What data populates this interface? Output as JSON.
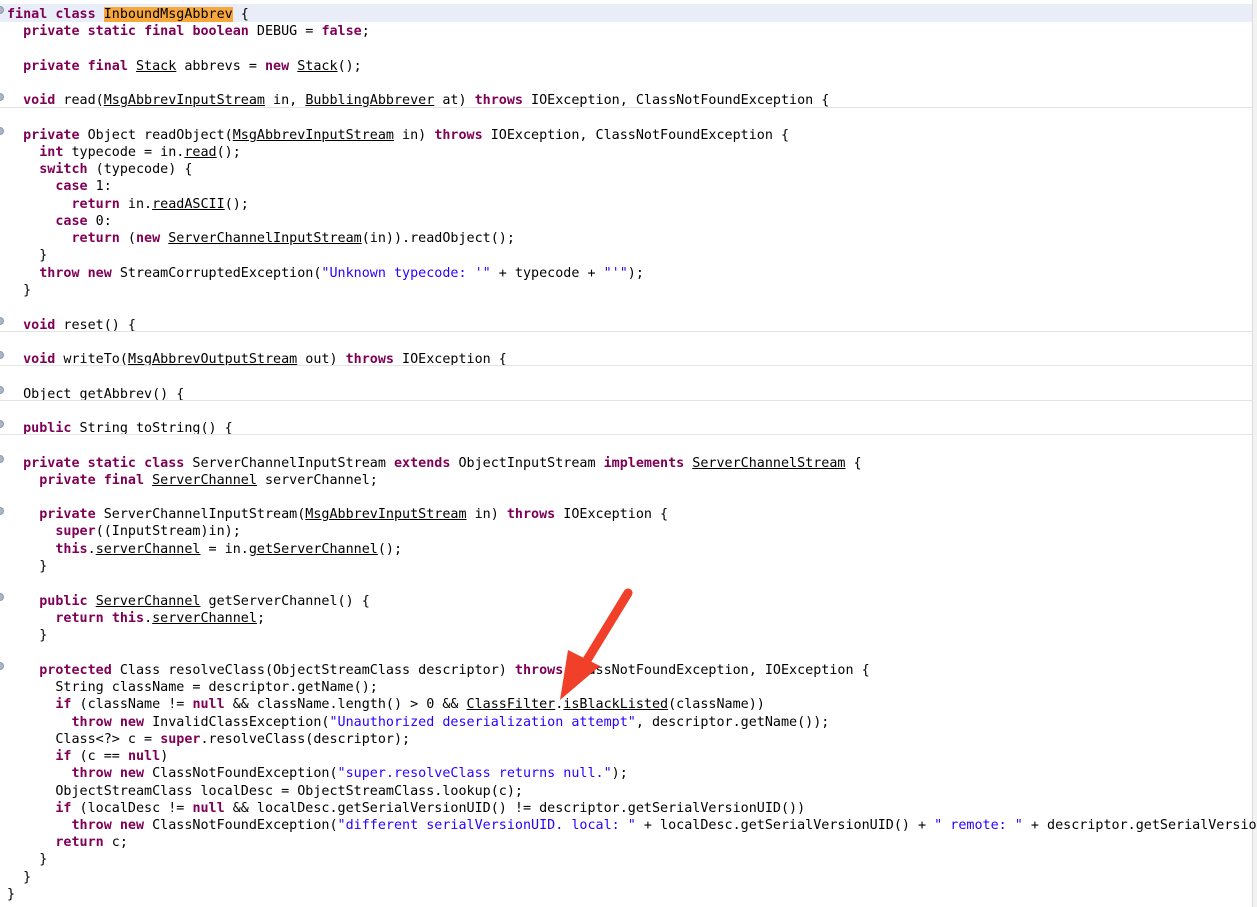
{
  "editor": {
    "lines": [
      [
        {
          "t": "final",
          "c": "kw"
        },
        {
          "t": " "
        },
        {
          "t": "class",
          "c": "kw"
        },
        {
          "t": " "
        },
        {
          "t": "InboundMsgAbbrev",
          "c": "hl"
        },
        {
          "t": " {"
        }
      ],
      [
        {
          "t": "  "
        },
        {
          "t": "private",
          "c": "kw"
        },
        {
          "t": " "
        },
        {
          "t": "static",
          "c": "kw"
        },
        {
          "t": " "
        },
        {
          "t": "final",
          "c": "kw"
        },
        {
          "t": " "
        },
        {
          "t": "boolean",
          "c": "kw"
        },
        {
          "t": " DEBUG = "
        },
        {
          "t": "false",
          "c": "kw"
        },
        {
          "t": ";"
        }
      ],
      [
        {
          "t": "  "
        },
        {
          "t": "private",
          "c": "kw"
        },
        {
          "t": " "
        },
        {
          "t": "final",
          "c": "kw"
        },
        {
          "t": " "
        },
        {
          "t": "Stack",
          "c": "ul"
        },
        {
          "t": " abbrevs = "
        },
        {
          "t": "new",
          "c": "kw"
        },
        {
          "t": " "
        },
        {
          "t": "Stack",
          "c": "ul"
        },
        {
          "t": "();"
        }
      ],
      [
        {
          "t": "  "
        },
        {
          "t": "void",
          "c": "kw"
        },
        {
          "t": " read("
        },
        {
          "t": "MsgAbbrevInputStream",
          "c": "ul"
        },
        {
          "t": " in, "
        },
        {
          "t": "BubblingAbbrever",
          "c": "ul"
        },
        {
          "t": " at) "
        },
        {
          "t": "throws",
          "c": "kw"
        },
        {
          "t": " IOException, ClassNotFoundException {"
        }
      ],
      [
        {
          "t": "  "
        },
        {
          "t": "private",
          "c": "kw"
        },
        {
          "t": " Object readObject("
        },
        {
          "t": "MsgAbbrevInputStream",
          "c": "ul"
        },
        {
          "t": " in) "
        },
        {
          "t": "throws",
          "c": "kw"
        },
        {
          "t": " IOException, ClassNotFoundException {"
        }
      ],
      [
        {
          "t": "    "
        },
        {
          "t": "int",
          "c": "kw"
        },
        {
          "t": " typecode = in."
        },
        {
          "t": "read",
          "c": "ul"
        },
        {
          "t": "();"
        }
      ],
      [
        {
          "t": "    "
        },
        {
          "t": "switch",
          "c": "kw"
        },
        {
          "t": " (typecode) {"
        }
      ],
      [
        {
          "t": "      "
        },
        {
          "t": "case",
          "c": "kw"
        },
        {
          "t": " 1:"
        }
      ],
      [
        {
          "t": "        "
        },
        {
          "t": "return",
          "c": "kw"
        },
        {
          "t": " in."
        },
        {
          "t": "readASCII",
          "c": "ul"
        },
        {
          "t": "();"
        }
      ],
      [
        {
          "t": "      "
        },
        {
          "t": "case",
          "c": "kw"
        },
        {
          "t": " 0:"
        }
      ],
      [
        {
          "t": "        "
        },
        {
          "t": "return",
          "c": "kw"
        },
        {
          "t": " ("
        },
        {
          "t": "new",
          "c": "kw"
        },
        {
          "t": " "
        },
        {
          "t": "ServerChannelInputStream",
          "c": "ul"
        },
        {
          "t": "(in)).readObject();"
        }
      ],
      [
        {
          "t": "    }"
        }
      ],
      [
        {
          "t": "    "
        },
        {
          "t": "throw",
          "c": "kw"
        },
        {
          "t": " "
        },
        {
          "t": "new",
          "c": "kw"
        },
        {
          "t": " StreamCorruptedException("
        },
        {
          "t": "\"Unknown typecode: '\"",
          "c": "str"
        },
        {
          "t": " + typecode + "
        },
        {
          "t": "\"'\"",
          "c": "str"
        },
        {
          "t": ");"
        }
      ],
      [
        {
          "t": "  }"
        }
      ],
      [
        {
          "t": "  "
        },
        {
          "t": "void",
          "c": "kw"
        },
        {
          "t": " reset() {"
        }
      ],
      [
        {
          "t": "  "
        },
        {
          "t": "void",
          "c": "kw"
        },
        {
          "t": " writeTo("
        },
        {
          "t": "MsgAbbrevOutputStream",
          "c": "ul"
        },
        {
          "t": " out) "
        },
        {
          "t": "throws",
          "c": "kw"
        },
        {
          "t": " IOException {"
        }
      ],
      [
        {
          "t": "  Object getAbbrev() {"
        }
      ],
      [
        {
          "t": "  "
        },
        {
          "t": "public",
          "c": "kw"
        },
        {
          "t": " String toString() {"
        }
      ],
      [
        {
          "t": "  "
        },
        {
          "t": "private",
          "c": "kw"
        },
        {
          "t": " "
        },
        {
          "t": "static",
          "c": "kw"
        },
        {
          "t": " "
        },
        {
          "t": "class",
          "c": "kw"
        },
        {
          "t": " ServerChannelInputStream "
        },
        {
          "t": "extends",
          "c": "kw"
        },
        {
          "t": " ObjectInputStream "
        },
        {
          "t": "implements",
          "c": "kw"
        },
        {
          "t": " "
        },
        {
          "t": "ServerChannelStream",
          "c": "ul"
        },
        {
          "t": " {"
        }
      ],
      [
        {
          "t": "    "
        },
        {
          "t": "private",
          "c": "kw"
        },
        {
          "t": " "
        },
        {
          "t": "final",
          "c": "kw"
        },
        {
          "t": " "
        },
        {
          "t": "ServerChannel",
          "c": "ul"
        },
        {
          "t": " serverChannel;"
        }
      ],
      [
        {
          "t": "    "
        },
        {
          "t": "private",
          "c": "kw"
        },
        {
          "t": " ServerChannelInputStream("
        },
        {
          "t": "MsgAbbrevInputStream",
          "c": "ul"
        },
        {
          "t": " in) "
        },
        {
          "t": "throws",
          "c": "kw"
        },
        {
          "t": " IOException {"
        }
      ],
      [
        {
          "t": "      "
        },
        {
          "t": "super",
          "c": "kw"
        },
        {
          "t": "((InputStream)in);"
        }
      ],
      [
        {
          "t": "      "
        },
        {
          "t": "this",
          "c": "kw"
        },
        {
          "t": "."
        },
        {
          "t": "serverChannel",
          "c": "ul"
        },
        {
          "t": " = in."
        },
        {
          "t": "getServerChannel",
          "c": "ul"
        },
        {
          "t": "();"
        }
      ],
      [
        {
          "t": "    }"
        }
      ],
      [
        {
          "t": "    "
        },
        {
          "t": "public",
          "c": "kw"
        },
        {
          "t": " "
        },
        {
          "t": "ServerChannel",
          "c": "ul"
        },
        {
          "t": " getServerChannel() {"
        }
      ],
      [
        {
          "t": "      "
        },
        {
          "t": "return",
          "c": "kw"
        },
        {
          "t": " "
        },
        {
          "t": "this",
          "c": "kw"
        },
        {
          "t": "."
        },
        {
          "t": "serverChannel",
          "c": "ul"
        },
        {
          "t": ";"
        }
      ],
      [
        {
          "t": "    }"
        }
      ],
      [
        {
          "t": "    "
        },
        {
          "t": "protected",
          "c": "kw"
        },
        {
          "t": " Class resolveClass(ObjectStreamClass descriptor) "
        },
        {
          "t": "throws",
          "c": "kw"
        },
        {
          "t": " ClassNotFoundException, IOException {"
        }
      ],
      [
        {
          "t": "      String className = descriptor.getName();"
        }
      ],
      [
        {
          "t": "      "
        },
        {
          "t": "if",
          "c": "kw"
        },
        {
          "t": " (className != "
        },
        {
          "t": "null",
          "c": "kw"
        },
        {
          "t": " && className.length() > 0 && "
        },
        {
          "t": "ClassFilter",
          "c": "ul"
        },
        {
          "t": "."
        },
        {
          "t": "isBlackListed",
          "c": "ul"
        },
        {
          "t": "(className))"
        }
      ],
      [
        {
          "t": "        "
        },
        {
          "t": "throw",
          "c": "kw"
        },
        {
          "t": " "
        },
        {
          "t": "new",
          "c": "kw"
        },
        {
          "t": " InvalidClassException("
        },
        {
          "t": "\"Unauthorized deserialization attempt\"",
          "c": "str"
        },
        {
          "t": ", descriptor.getName());"
        }
      ],
      [
        {
          "t": "      Class<?> c = "
        },
        {
          "t": "super",
          "c": "kw"
        },
        {
          "t": ".resolveClass(descriptor);"
        }
      ],
      [
        {
          "t": "      "
        },
        {
          "t": "if",
          "c": "kw"
        },
        {
          "t": " (c == "
        },
        {
          "t": "null",
          "c": "kw"
        },
        {
          "t": ")"
        }
      ],
      [
        {
          "t": "        "
        },
        {
          "t": "throw",
          "c": "kw"
        },
        {
          "t": " "
        },
        {
          "t": "new",
          "c": "kw"
        },
        {
          "t": " ClassNotFoundException("
        },
        {
          "t": "\"super.resolveClass returns null.\"",
          "c": "str"
        },
        {
          "t": ");"
        }
      ],
      [
        {
          "t": "      ObjectStreamClass localDesc = ObjectStreamClass.lookup(c);"
        }
      ],
      [
        {
          "t": "      "
        },
        {
          "t": "if",
          "c": "kw"
        },
        {
          "t": " (localDesc != "
        },
        {
          "t": "null",
          "c": "kw"
        },
        {
          "t": " && localDesc.getSerialVersionUID() != descriptor.getSerialVersionUID())"
        }
      ],
      [
        {
          "t": "        "
        },
        {
          "t": "throw",
          "c": "kw"
        },
        {
          "t": " "
        },
        {
          "t": "new",
          "c": "kw"
        },
        {
          "t": " ClassNotFoundException("
        },
        {
          "t": "\"different serialVersionUID. local: \"",
          "c": "str"
        },
        {
          "t": " + localDesc.getSerialVersionUID() + "
        },
        {
          "t": "\" remote: \"",
          "c": "str"
        },
        {
          "t": " + descriptor.getSerialVersionUID());"
        }
      ],
      [
        {
          "t": "      "
        },
        {
          "t": "return",
          "c": "kw"
        },
        {
          "t": " c;"
        }
      ],
      [
        {
          "t": "    }"
        }
      ],
      [
        {
          "t": "  }"
        }
      ],
      [
        {
          "t": "}"
        }
      ]
    ]
  },
  "annotation": {
    "arrow_color": "#f0402a",
    "points_to": "isBlackListed"
  },
  "colors": {
    "keyword": "#7f0055",
    "string": "#2a00ff",
    "class_highlight": "#f7a73c"
  }
}
